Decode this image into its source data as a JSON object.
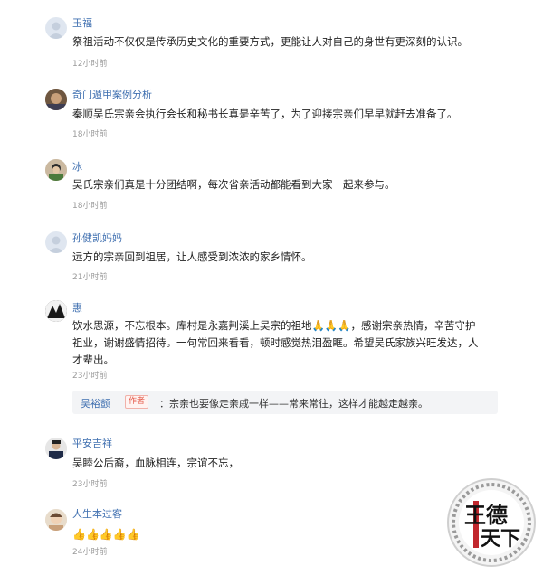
{
  "comments": [
    {
      "user": "玉福",
      "text": "祭祖活动不仅仅是传承历史文化的重要方式，更能让人对自己的身世有更深刻的认识。",
      "time": "12小时前",
      "avatar_icon": "default-avatar-icon"
    },
    {
      "user": "奇门遁甲案例分析",
      "text": "秦顺吴氏宗亲会执行会长和秘书长真是辛苦了，为了迎接宗亲们早早就赶去准备了。",
      "time": "18小时前",
      "avatar_icon": "photo-avatar-icon"
    },
    {
      "user": "冰",
      "text": "吴氏宗亲们真是十分团结啊，每次省亲活动都能看到大家一起来参与。",
      "time": "18小时前",
      "avatar_icon": "photo-avatar-icon"
    },
    {
      "user": "孙健凯妈妈",
      "text": "远方的宗亲回到祖居，让人感受到浓浓的家乡情怀。",
      "time": "21小时前",
      "avatar_icon": "default-avatar-icon"
    },
    {
      "user": "惠",
      "text": "饮水思源，不忘根本。库村是永嘉荆溪上吴宗的祖地🙏🙏🙏，感谢宗亲热情，辛苦守护祖业，谢谢盛情招待。一句常回来看看，顿时感觉热泪盈眶。希望吴氏家族兴旺发达，人才辈出。",
      "time": "23小时前",
      "avatar_icon": "photo-avatar-icon"
    },
    {
      "user": "平安吉祥",
      "text": "吴睦公后裔，血脉相连，宗谊不忘，",
      "time": "23小时前",
      "avatar_icon": "photo-avatar-icon"
    },
    {
      "user": "人生本过客",
      "text": "👍👍👍👍👍",
      "time": "24小时前",
      "avatar_icon": "photo-avatar-icon"
    }
  ],
  "reply": {
    "user": "吴裕颤",
    "badge": "作者",
    "text": "：宗亲也要像走亲戚一样——常来常往，这样才能越走越亲。"
  },
  "watermark": {
    "line1": "王德",
    "line2": "天下"
  },
  "colors": {
    "username": "#3f6fb0",
    "text": "#222222",
    "time": "#9a9a9a",
    "badge": "#e45a4a"
  }
}
